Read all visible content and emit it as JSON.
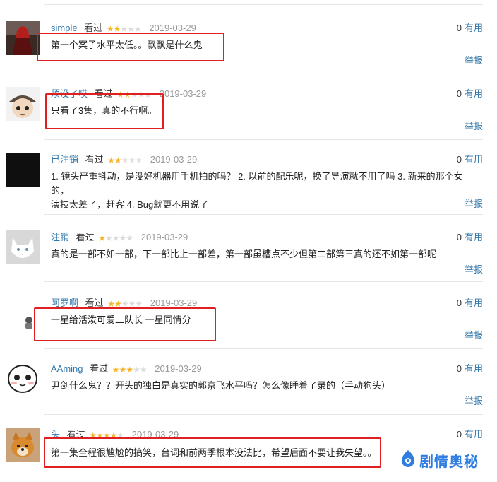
{
  "reviews": [
    {
      "username": "simple",
      "watched": "看过",
      "rating": 2,
      "date": "2019-03-29",
      "votes": "0",
      "vote_label": "有用",
      "content": "第一个案子水平太低。。飘飘是什么鬼",
      "report": "举报"
    },
    {
      "username": "烦没了哎",
      "watched": "看过",
      "rating": 2,
      "date": "2019-03-29",
      "votes": "0",
      "vote_label": "有用",
      "content": "只看了3集，真的不行啊。",
      "report": "举报"
    },
    {
      "username": "已注销",
      "watched": "看过",
      "rating": 2,
      "date": "2019-03-29",
      "votes": "0",
      "vote_label": "有用",
      "content_line1": "1. 镜头严重抖动，是没好机器用手机拍的吗？ 2. 以前的配乐呢，换了导演就不用了吗 3. 新来的那个女的，",
      "content_line2": "演技太差了，赶客 4. Bug就更不用说了",
      "report": "举报"
    },
    {
      "username": "注销",
      "watched": "看过",
      "rating": 1,
      "date": "2019-03-29",
      "votes": "0",
      "vote_label": "有用",
      "content": "真的是一部不如一部，下一部比上一部差，第一部虽槽点不少但第二部第三真的还不如第一部呢",
      "report": "举报"
    },
    {
      "username": "阿罗啊",
      "watched": "看过",
      "rating": 2,
      "date": "2019-03-29",
      "votes": "0",
      "vote_label": "有用",
      "content": "一星给活泼可爱二队长 一星同情分",
      "report": "举报"
    },
    {
      "username": "AAming",
      "watched": "看过",
      "rating": 3,
      "date": "2019-03-29",
      "votes": "0",
      "vote_label": "有用",
      "content": "尹剑什么鬼？？开头的独白是真实的郭京飞水平吗？怎么像睡着了录的（手动狗头）",
      "report": "举报"
    },
    {
      "username": "头",
      "watched": "看过",
      "rating": 4,
      "date": "2019-03-29",
      "votes": "0",
      "vote_label": "有用",
      "content": "第一集全程很尴尬的搞笑，台词和前两季根本没法比，希望后面不要让我失望。。",
      "report": ""
    }
  ],
  "watermark": {
    "text": "剧情奥秘",
    "icon": "brand-logo-icon"
  },
  "colors": {
    "link": "#3377aa",
    "star": "#f7b52c",
    "highlight": "#e02020",
    "watermark": "#2f7de1"
  }
}
